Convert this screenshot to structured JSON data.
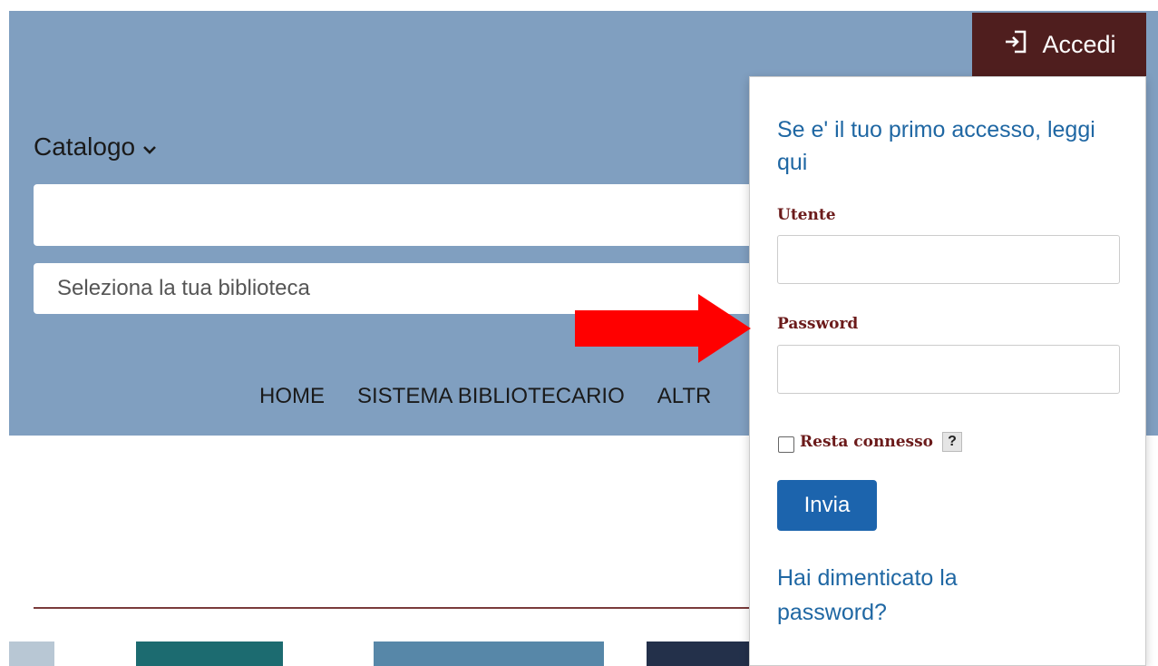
{
  "header": {
    "login_label": "Accedi",
    "catalog_label": "Catalogo",
    "search_value": "",
    "library_placeholder": "Seleziona la tua biblioteca"
  },
  "nav": {
    "items": [
      "HOME",
      "SISTEMA BIBLIOTECARIO",
      "ALTR"
    ]
  },
  "login_dropdown": {
    "first_access_link": "Se e' il tuo primo accesso, leggi qui",
    "username_label": "Utente",
    "username_value": "",
    "password_label": "Password",
    "password_value": "",
    "remember_label": "Resta connesso",
    "remember_checked": false,
    "help_label": "?",
    "submit_label": "Invia",
    "forgot_link": "Hai dimenticato la password?"
  },
  "colors": {
    "header_bg": "#809fc0",
    "login_button_bg": "#4f1e1e",
    "link": "#1f67a3",
    "label": "#6b1a1a",
    "submit_bg": "#1c64ad",
    "annotation_arrow": "#ff0000"
  },
  "icons": {
    "login": "sign-in-icon",
    "catalog_dropdown": "chevron-down-icon",
    "annotation": "red-arrow-icon"
  }
}
